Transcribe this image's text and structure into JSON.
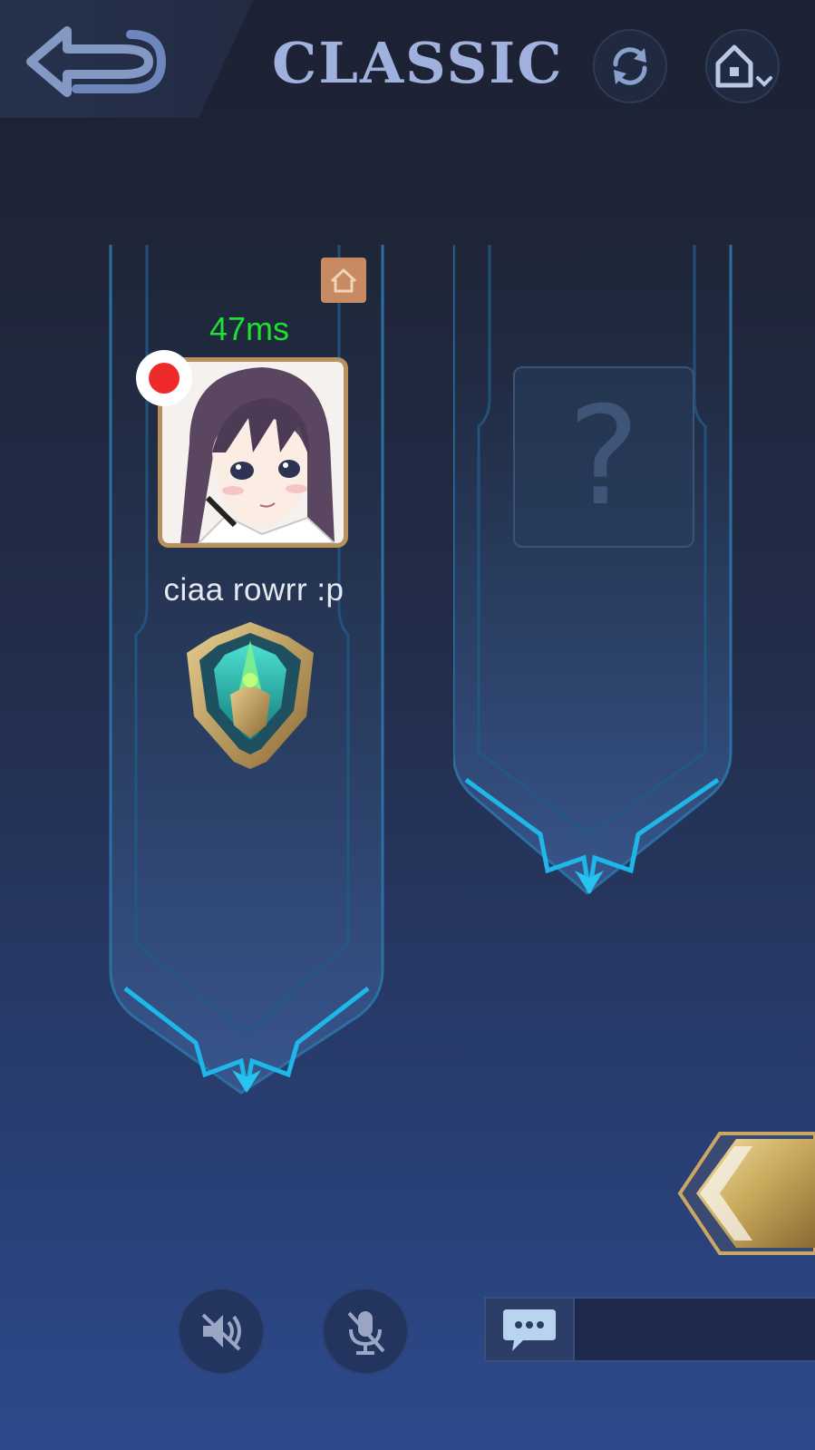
{
  "header": {
    "title": "CLASSIC",
    "back_icon": "back-arrow-icon",
    "refresh_icon": "refresh-icon",
    "home_icon": "home-dropdown-icon"
  },
  "player_slots": [
    {
      "ping": "47ms",
      "name": "ciaa rowrr :p",
      "status_icons": [
        "home-badge-icon",
        "recording-dot-icon",
        "rank-emblem-icon"
      ]
    },
    {
      "placeholder": "?"
    }
  ],
  "bottom_bar": {
    "speaker_icon": "speaker-muted-icon",
    "mic_icon": "mic-muted-icon",
    "chat_icon": "chat-bubble-icon",
    "chat_value": ""
  },
  "colors": {
    "ping": "#1fe030",
    "title": "#9fb1dc",
    "frame_glow": "#1fb6e8",
    "gold": "#c8a85a"
  }
}
